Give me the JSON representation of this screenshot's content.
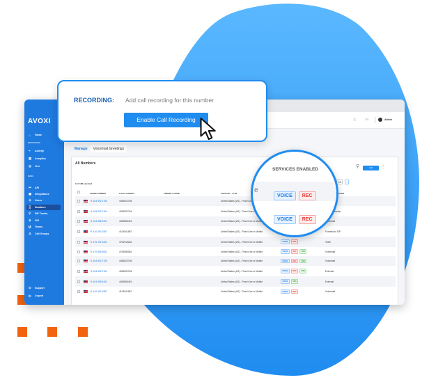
{
  "colors": {
    "brand_blue": "#1f7ae0",
    "accent_orange": "#f2630f",
    "blob": "#2196f3"
  },
  "app": {
    "logo": "AVOXI"
  },
  "sidebar": {
    "sections": [
      "REPORTING",
      "MAIN"
    ],
    "items": [
      {
        "label": "Home",
        "icon": "home-icon"
      },
      {
        "label": "Activity",
        "icon": "activity-icon"
      },
      {
        "label": "Analytics",
        "icon": "analytics-icon"
      },
      {
        "label": "Live",
        "icon": "live-icon"
      },
      {
        "label": "API",
        "icon": "api-icon"
      },
      {
        "label": "Integrations",
        "icon": "integrations-icon"
      },
      {
        "label": "Users",
        "icon": "users-icon"
      },
      {
        "label": "Numbers",
        "icon": "numbers-icon",
        "active": true
      },
      {
        "label": "SIP Trunks",
        "icon": "sip-icon"
      },
      {
        "label": "IVR",
        "icon": "ivr-icon"
      },
      {
        "label": "Teams",
        "icon": "teams-icon"
      },
      {
        "label": "Call Groups",
        "icon": "call-groups-icon"
      }
    ],
    "footer": [
      {
        "label": "Support",
        "icon": "support-icon"
      },
      {
        "label": "Logout",
        "icon": "logout-icon"
      }
    ]
  },
  "header": {
    "user": "Admin"
  },
  "tabs": [
    "Manage",
    "Voicemail Greetings"
  ],
  "card": {
    "title": "All Numbers",
    "selected": "0 of 183 selected",
    "add_label": "Add",
    "pagination": {
      "current": "5",
      "ellipsis": "•••",
      "last": "10",
      "next": "›"
    },
    "columns": [
      "PHONE NUMBER",
      "LOCAL FORMAT",
      "FRIENDLY NAME",
      "COUNTRY - TYPE",
      "SERVICES ENABLED",
      "CALL DESTINATION"
    ],
    "rows": [
      {
        "phone": "+1 404 592 2765",
        "local": "4045922765",
        "country": "United States (US) - Fixed Line or Mobile",
        "services": [
          "VOICE",
          "REC"
        ],
        "dest": "Team"
      },
      {
        "phone": "+1 404 592 2764",
        "local": "4045922764",
        "country": "United States (US) - Fixed Line or Mobile",
        "services": [
          "VOICE",
          "REC"
        ],
        "dest": "User Extension"
      },
      {
        "phone": "+1 404 555 6491",
        "local": "4045556491",
        "country": "United States (US) - Fixed Line or Mobile",
        "services": [
          "VOICE"
        ],
        "dest": "Voicemail"
      },
      {
        "phone": "+1 410 454 1587",
        "local": "4104541587",
        "country": "United States (US) - Fixed Line or Mobile",
        "services": [
          "VOICE"
        ],
        "dest": "Forward to SIP"
      },
      {
        "phone": "+1 470 291 5262",
        "local": "4702915262",
        "country": "United States (US) - Fixed Line or Mobile",
        "services": [
          "VOICE",
          "REC"
        ],
        "dest": "Team"
      },
      {
        "phone": "+1 470 555 5082",
        "local": "4705555082",
        "country": "United States (US) - Fixed Line or Mobile",
        "services": [
          "VOICE",
          "REC",
          "SMS"
        ],
        "dest": "Voicemail"
      },
      {
        "phone": "+1 404 592 2765",
        "local": "4045922765",
        "country": "United States (US) - Fixed Line or Mobile",
        "services": [
          "VOICE",
          "REC",
          "SMS"
        ],
        "dest": "Voicemail"
      },
      {
        "phone": "+1 404 592 2764",
        "local": "4045922764",
        "country": "United States (US) - Fixed Line or Mobile",
        "services": [
          "VOICE",
          "REC",
          "SMS"
        ],
        "dest": "External"
      },
      {
        "phone": "+1 404 555 6491",
        "local": "4045556491",
        "country": "United States (US) - Fixed Line or Mobile",
        "services": [
          "VOICE",
          "SMS"
        ],
        "dest": "External"
      },
      {
        "phone": "+1 410 454 1587",
        "local": "4104541587",
        "country": "United States (US) - Fixed Line or Mobile",
        "services": [
          "VOICE",
          "REC"
        ],
        "dest": "Voicemail"
      }
    ]
  },
  "popup": {
    "label": "RECORDING:",
    "description": "Add call recording for this number",
    "button": "Enable Call Recording"
  },
  "lens": {
    "title": "SERVICES ENABLED",
    "partial": "e",
    "rows": [
      [
        "VOICE",
        "REC"
      ],
      [
        "VOICE",
        "REC"
      ]
    ]
  }
}
